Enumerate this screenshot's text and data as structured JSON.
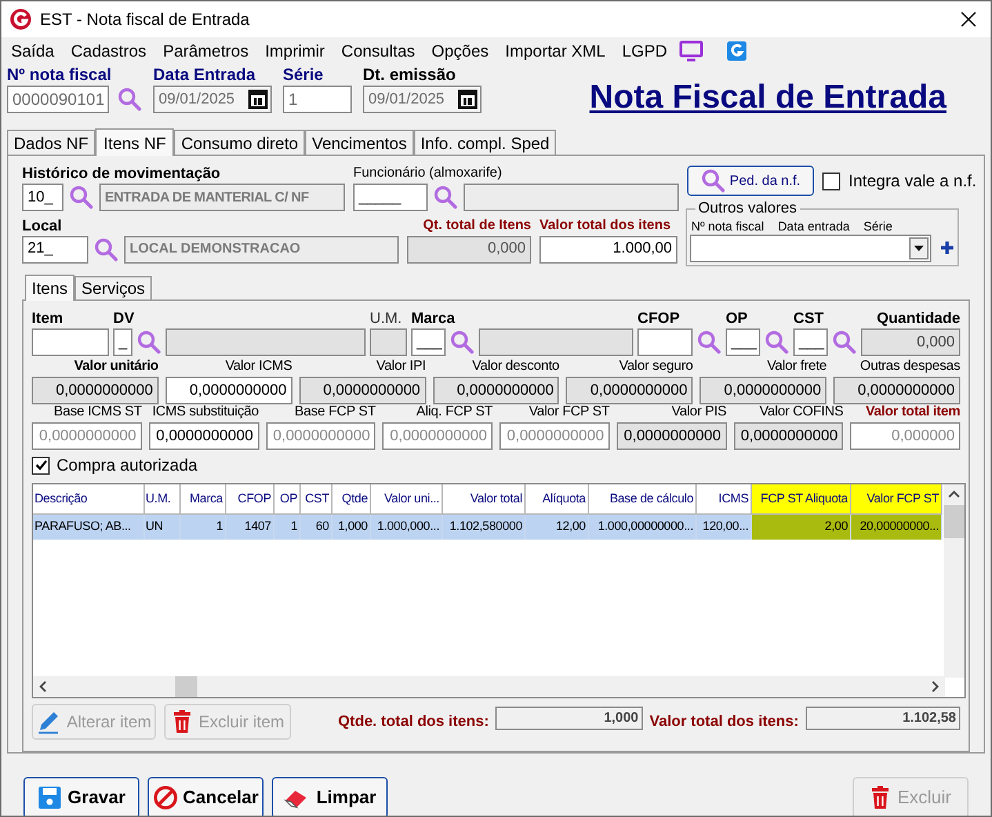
{
  "window": {
    "title": "EST - Nota fiscal de Entrada"
  },
  "menu": [
    "Saída",
    "Cadastros",
    "Parâmetros",
    "Imprimir",
    "Consultas",
    "Opções",
    "Importar XML",
    "LGPD"
  ],
  "header": {
    "fields": [
      {
        "label": "Nº nota fiscal",
        "value": "0000090101",
        "kind": "lookup",
        "accent": true
      },
      {
        "label": "Data Entrada",
        "value": "09/01/2025",
        "kind": "date",
        "accent": true
      },
      {
        "label": "Série",
        "value": "1",
        "kind": "text",
        "accent": true
      },
      {
        "label": "Dt. emissão",
        "value": "09/01/2025",
        "kind": "date",
        "accent": false
      }
    ],
    "title": "Nota Fiscal de Entrada"
  },
  "tabs": [
    {
      "label": "Dados NF",
      "selected": false
    },
    {
      "label": "Itens NF",
      "selected": true
    },
    {
      "label": "Consumo direto",
      "selected": false
    },
    {
      "label": "Vencimentos",
      "selected": false
    },
    {
      "label": "Info. compl. Sped",
      "selected": false
    }
  ],
  "movement": {
    "historico": {
      "label": "Histórico de movimentação",
      "code": "10_",
      "description": "ENTRADA DE MANTERIAL C/ NF"
    },
    "funcionario": {
      "label": "Funcionário (almoxarife)",
      "code": "_____"
    },
    "ped_button": "Ped. da n.f.",
    "integra": {
      "label": "Integra vale a n.f.",
      "checked": false
    },
    "local": {
      "label": "Local",
      "code": "21_",
      "description": "LOCAL DEMONSTRACAO"
    },
    "qt_total": {
      "label": "Qt. total de Itens",
      "value": "0,000"
    },
    "valor_total": {
      "label": "Valor total dos itens",
      "value": "1.000,00"
    },
    "outros_valores": {
      "title": "Outros valores",
      "columns": [
        "Nº nota fiscal",
        "Data entrada",
        "Série"
      ]
    }
  },
  "subtabs": [
    {
      "label": "Itens",
      "selected": true
    },
    {
      "label": "Serviços",
      "selected": false
    }
  ],
  "item_row": [
    {
      "label": "Item",
      "bold": true,
      "lookup": false,
      "readonly": false
    },
    {
      "label": "DV",
      "value": "_",
      "bold": true,
      "lookup": true,
      "readonly": false
    },
    {
      "lookup": false,
      "readonly": true
    },
    {
      "label": "U.M.",
      "bold": false,
      "lookup": false,
      "readonly": true
    },
    {
      "label": "Marca",
      "value": "___",
      "bold": true,
      "lookup": true,
      "readonly": false
    },
    {
      "lookup": false,
      "readonly": true
    },
    {
      "label": "CFOP",
      "bold": true,
      "lookup": true,
      "readonly": false
    },
    {
      "label": "OP",
      "value": "___",
      "bold": true,
      "lookup": true,
      "readonly": false
    },
    {
      "label": "CST",
      "value": "___",
      "bold": true,
      "lookup": true,
      "readonly": false
    },
    {
      "label": "Quantidade",
      "value": "0,000",
      "bold": true,
      "lookup": false,
      "readonly": true
    }
  ],
  "values_row": [
    {
      "label": "Valor unitário",
      "value": "0,0000000000",
      "bold": true,
      "readonly": true
    },
    {
      "label": "Valor ICMS",
      "value": "0,0000000000",
      "bold": false,
      "readonly": false
    },
    {
      "label": "Valor IPI",
      "value": "0,0000000000",
      "bold": false,
      "readonly": true
    },
    {
      "label": "Valor desconto",
      "value": "0,0000000000",
      "bold": false,
      "readonly": true
    },
    {
      "label": "Valor seguro",
      "value": "0,0000000000",
      "bold": false,
      "readonly": true
    },
    {
      "label": "Valor frete",
      "value": "0,0000000000",
      "bold": false,
      "readonly": true
    },
    {
      "label": "Outras despesas",
      "value": "0,0000000000",
      "bold": false,
      "readonly": true
    }
  ],
  "taxes_row": [
    {
      "label": "Base ICMS ST",
      "value": "0,0000000000",
      "alert": false,
      "readonly": false,
      "disabled": true
    },
    {
      "label": "ICMS substituição",
      "value": "0,0000000000",
      "alert": false,
      "readonly": false,
      "disabled": false
    },
    {
      "label": "Base FCP ST",
      "value": "0,0000000000",
      "alert": false,
      "readonly": false,
      "disabled": true
    },
    {
      "label": "Aliq. FCP ST",
      "value": "0,0000000000",
      "alert": false,
      "readonly": false,
      "disabled": true
    },
    {
      "label": "Valor FCP ST",
      "value": "0,0000000000",
      "alert": false,
      "readonly": false,
      "disabled": true
    },
    {
      "label": "Valor PIS",
      "value": "0,0000000000",
      "alert": false,
      "readonly": true,
      "disabled": false
    },
    {
      "label": "Valor COFINS",
      "value": "0,0000000000",
      "alert": false,
      "readonly": true,
      "disabled": false
    },
    {
      "label": "Valor total item",
      "value": "0,000000",
      "alert": true,
      "readonly": false,
      "disabled": true
    }
  ],
  "compra_autorizada": {
    "label": "Compra autorizada",
    "checked": true
  },
  "grid": {
    "columns": [
      {
        "label": "Descrição",
        "highlighted": false
      },
      {
        "label": "U.M.",
        "highlighted": false
      },
      {
        "label": "Marca",
        "highlighted": false
      },
      {
        "label": "CFOP",
        "highlighted": false
      },
      {
        "label": "OP",
        "highlighted": false
      },
      {
        "label": "CST",
        "highlighted": false
      },
      {
        "label": "Qtde",
        "highlighted": false
      },
      {
        "label": "Valor uni...",
        "highlighted": false
      },
      {
        "label": "Valor total",
        "highlighted": false
      },
      {
        "label": "Alíquota",
        "highlighted": false
      },
      {
        "label": "Base de cálculo",
        "highlighted": false
      },
      {
        "label": "ICMS",
        "highlighted": false
      },
      {
        "label": "FCP ST Aliquota",
        "highlighted": true
      },
      {
        "label": "Valor FCP ST",
        "highlighted": true
      }
    ],
    "rows": [
      {
        "selected": true,
        "cells": [
          "PARAFUSO; AB...",
          "UN",
          "1",
          "1407",
          "1",
          "60",
          "1,000",
          "1.000,000...",
          "1.102,580000",
          "12,00",
          "1.000,00000000...",
          "120,00...",
          "2,00",
          "20,00000000..."
        ]
      }
    ]
  },
  "item_buttons": [
    {
      "label": "Alterar item",
      "kind": "edit",
      "disabled": true
    },
    {
      "label": "Excluir item",
      "kind": "delete",
      "disabled": true
    }
  ],
  "totals": [
    {
      "label": "Qtde. total dos itens:",
      "value": "1,000"
    },
    {
      "label": "Valor total dos itens:",
      "value": "1.102,58"
    }
  ],
  "footer_buttons": [
    {
      "label": "Gravar",
      "kind": "save",
      "disabled": false
    },
    {
      "label": "Cancelar",
      "kind": "cancel",
      "disabled": false
    },
    {
      "label": "Limpar",
      "kind": "clear",
      "disabled": false
    },
    {
      "label": "Excluir",
      "kind": "delete",
      "disabled": true
    }
  ]
}
